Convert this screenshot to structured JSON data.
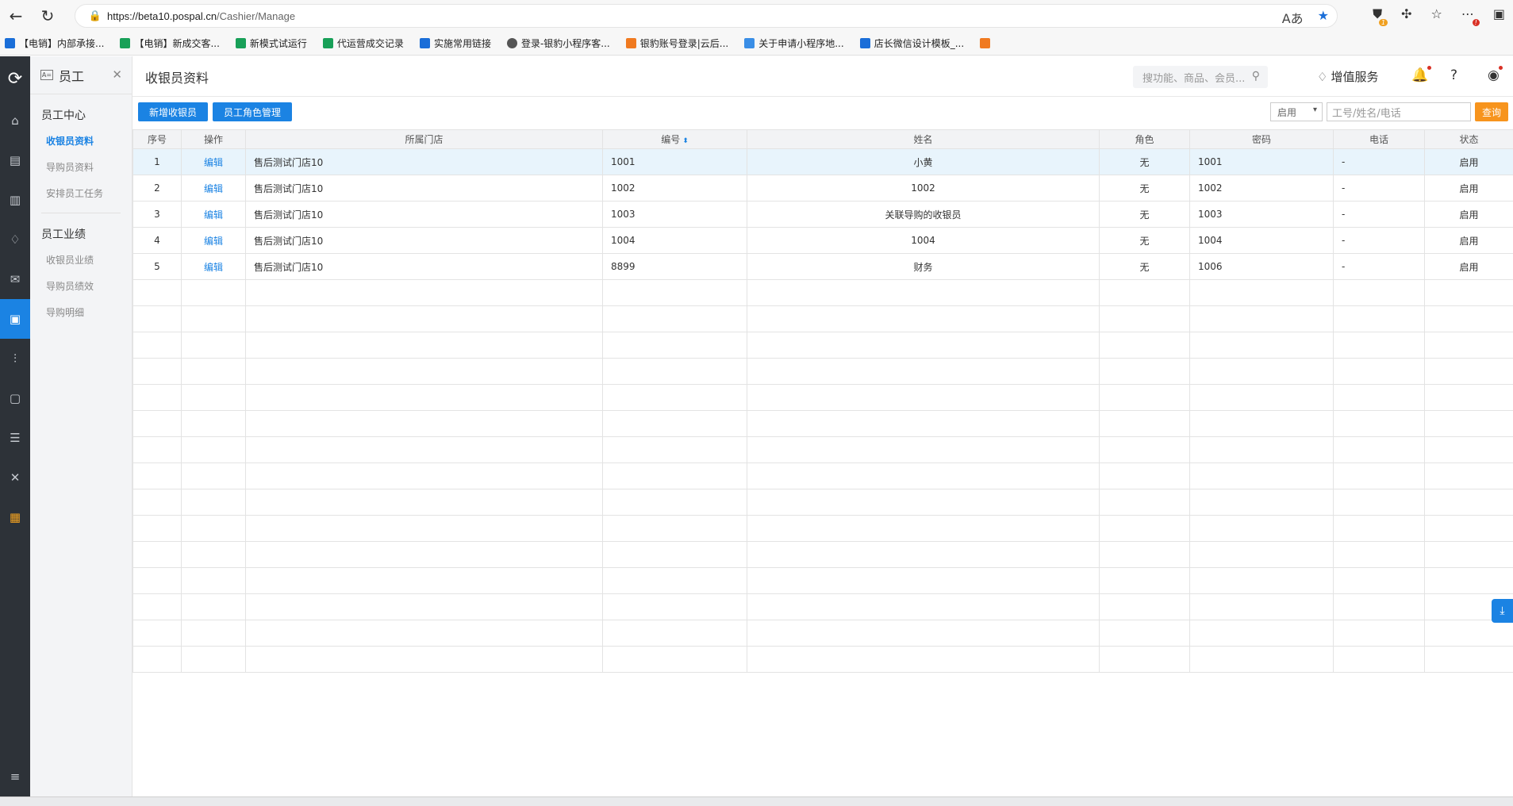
{
  "browser": {
    "url_host": "https://beta10.pospal.cn",
    "url_path": "/Cashier/Manage"
  },
  "bookmarks": [
    {
      "label": "【电销】内部承接...",
      "color": "#1a6ed8"
    },
    {
      "label": "【电销】新成交客...",
      "color": "#18a058"
    },
    {
      "label": "新模式试运行",
      "color": "#18a058"
    },
    {
      "label": "代运营成交记录",
      "color": "#18a058"
    },
    {
      "label": "实施常用链接",
      "color": "#1a6ed8"
    },
    {
      "label": "登录-银豹小程序客...",
      "color": "#555555"
    },
    {
      "label": "银豹账号登录|云后...",
      "color": "#f07a20"
    },
    {
      "label": "关于申请小程序地...",
      "color": "#3a8ee6"
    },
    {
      "label": "店长微信设计模板_...",
      "color": "#1a6ed8"
    },
    {
      "label": "",
      "color": "#f07a20"
    }
  ],
  "submenu": {
    "title": "员工",
    "groups": [
      {
        "title": "员工中心",
        "items": [
          "收银员资料",
          "导购员资料",
          "安排员工任务"
        ]
      },
      {
        "title": "员工业绩",
        "items": [
          "收银员业绩",
          "导购员绩效",
          "导购明细"
        ]
      }
    ]
  },
  "topbar": {
    "page_title": "收银员资料",
    "search_placeholder": "搜功能、商品、会员...",
    "value_added": "增值服务"
  },
  "toolbar": {
    "add_cashier": "新增收银员",
    "role_manage": "员工角色管理",
    "status_select": "启用",
    "filter_placeholder": "工号/姓名/电话",
    "query": "查询"
  },
  "table": {
    "headers": [
      "序号",
      "操作",
      "所属门店",
      "编号",
      "姓名",
      "角色",
      "密码",
      "电话",
      "状态"
    ],
    "rows": [
      {
        "no": "1",
        "op": "编辑",
        "store": "售后测试门店10",
        "code": "1001",
        "name": "小黄",
        "role": "无",
        "pwd": "1001",
        "phone": "-",
        "status": "启用"
      },
      {
        "no": "2",
        "op": "编辑",
        "store": "售后测试门店10",
        "code": "1002",
        "name": "1002",
        "role": "无",
        "pwd": "1002",
        "phone": "-",
        "status": "启用"
      },
      {
        "no": "3",
        "op": "编辑",
        "store": "售后测试门店10",
        "code": "1003",
        "name": "关联导购的收银员",
        "role": "无",
        "pwd": "1003",
        "phone": "-",
        "status": "启用"
      },
      {
        "no": "4",
        "op": "编辑",
        "store": "售后测试门店10",
        "code": "1004",
        "name": "1004",
        "role": "无",
        "pwd": "1004",
        "phone": "-",
        "status": "启用"
      },
      {
        "no": "5",
        "op": "编辑",
        "store": "售后测试门店10",
        "code": "8899",
        "name": "财务",
        "role": "无",
        "pwd": "1006",
        "phone": "-",
        "status": "启用"
      }
    ]
  },
  "colors": {
    "accent": "#1b83e3",
    "query": "#f7941d",
    "rail": "#2d3238"
  }
}
